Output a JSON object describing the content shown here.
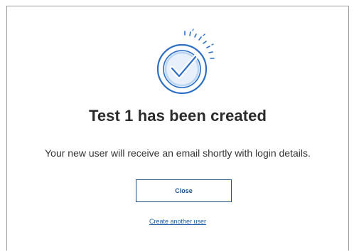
{
  "dialog": {
    "title": "Test 1 has been created",
    "message": "Your new user will receive an email shortly with login details.",
    "close_label": "Close",
    "create_another_label": "Create another user",
    "illustration_icon": "check-circle-icon"
  },
  "colors": {
    "accent": "#1f4f8a",
    "link": "#1f5fa8",
    "icon_outer": "#2e6fc6",
    "icon_inner": "#bcd6f4"
  }
}
